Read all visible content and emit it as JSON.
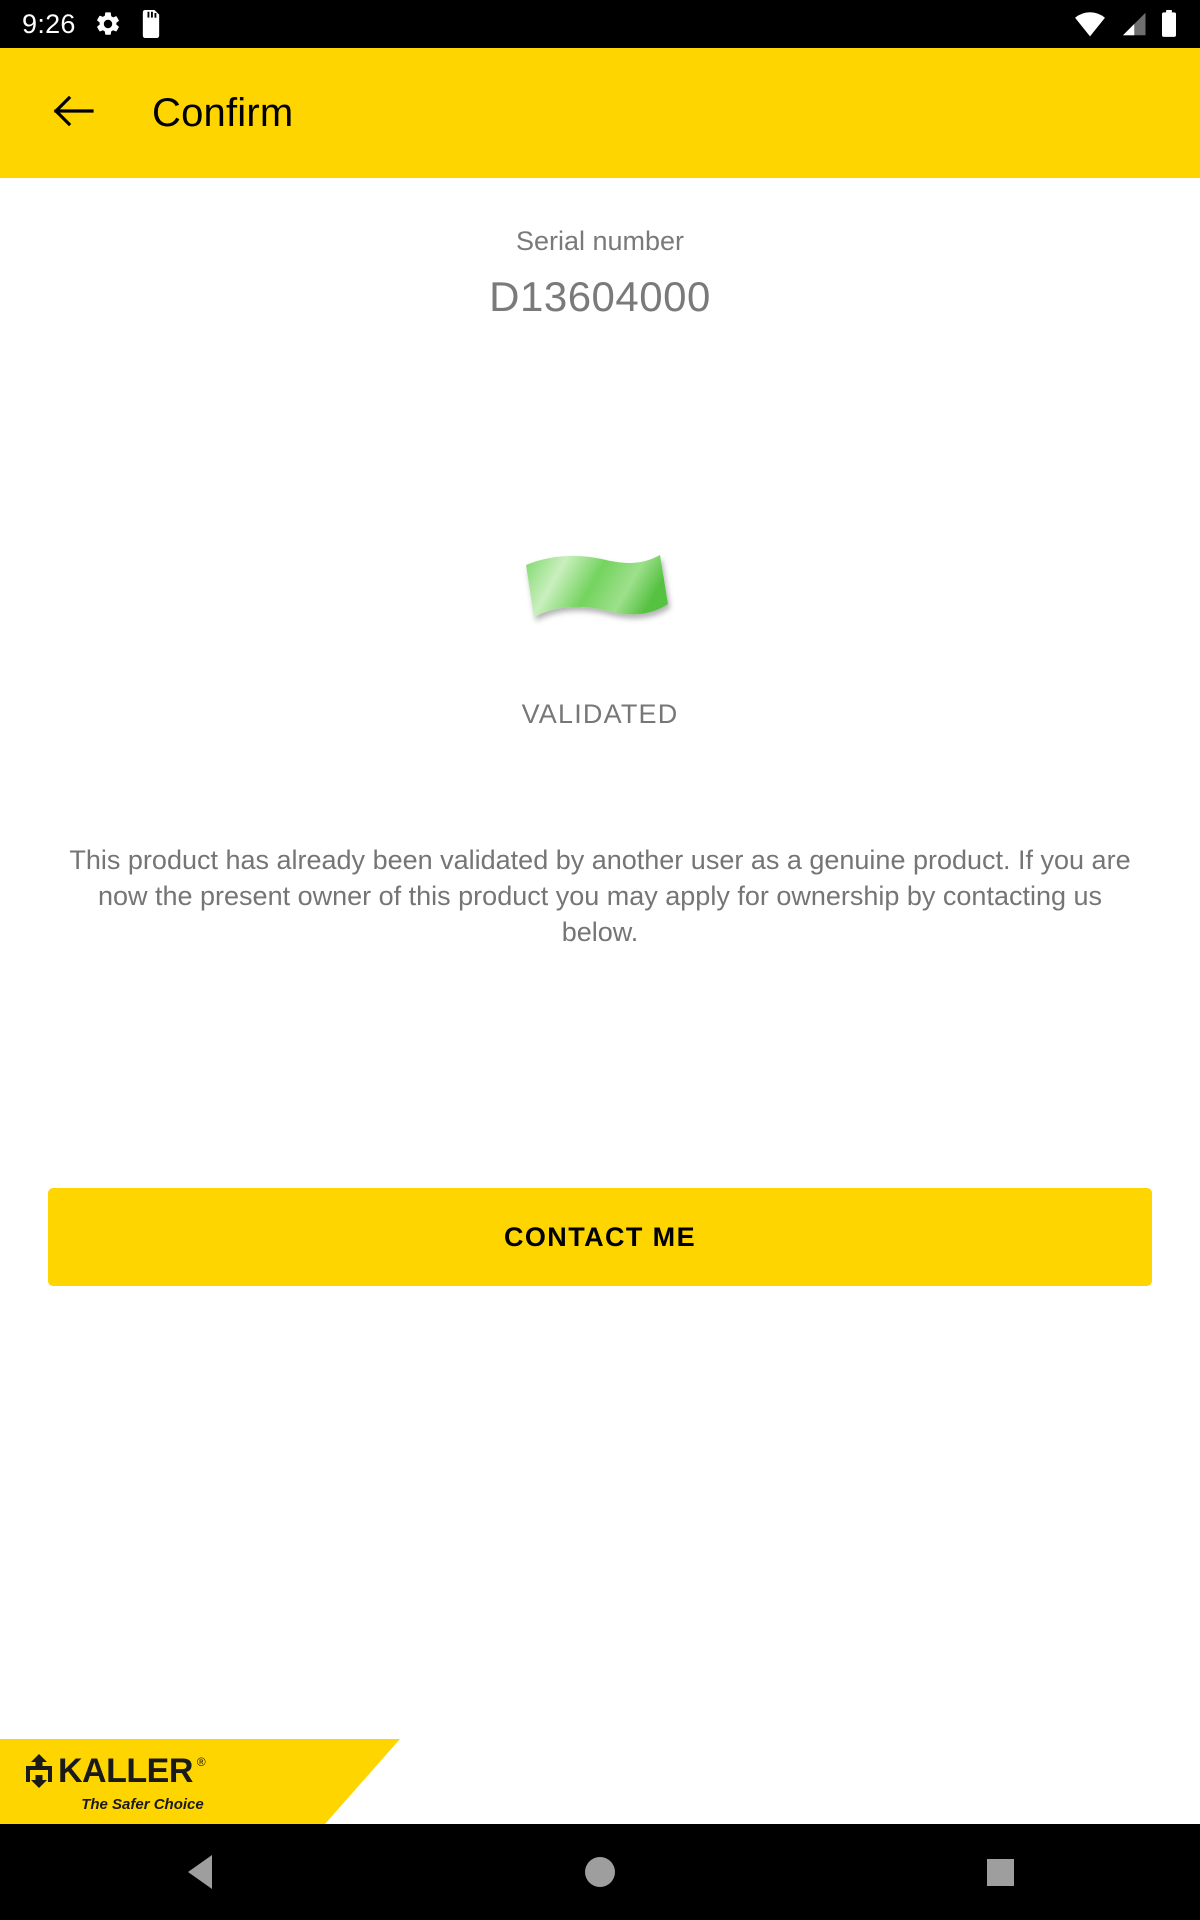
{
  "status_bar": {
    "time": "9:26",
    "icons_left": [
      "gear-icon",
      "sd-card-icon"
    ],
    "icons_right": [
      "wifi-icon",
      "cellular-signal-icon",
      "battery-icon"
    ]
  },
  "app_bar": {
    "back_icon": "back-arrow-icon",
    "title": "Confirm",
    "background_color": "#ffd500"
  },
  "main": {
    "serial_label": "Serial number",
    "serial_value": "D13604000",
    "status_icon": "green-flag-icon",
    "status_icon_color": "#6ed45a",
    "status_text": "VALIDATED",
    "description": "This product has already been validated by another user as a genuine product. If you are now the present owner of this product you may apply for ownership by contacting us below."
  },
  "cta": {
    "label": "CONTACT ME",
    "background_color": "#ffd500",
    "text_color": "#000000"
  },
  "brand": {
    "name": "KALLER",
    "registered_mark": "®",
    "tagline": "The Safer Choice",
    "logo_icon": "kaller-spring-logo-icon",
    "background_color": "#ffd500"
  },
  "nav_bar": {
    "back": "nav-back-icon",
    "home": "nav-home-icon",
    "recents": "nav-recents-icon",
    "icon_color": "#9e9e9e"
  }
}
